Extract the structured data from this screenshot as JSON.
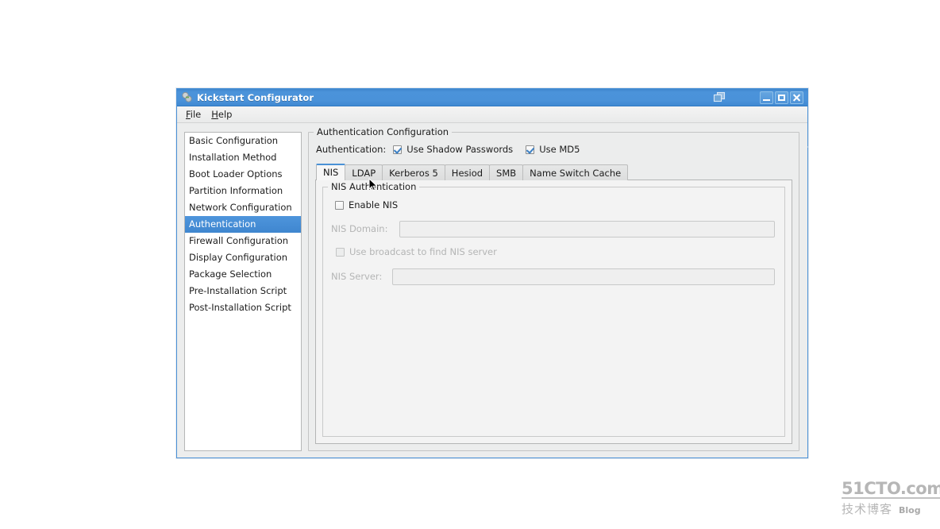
{
  "window": {
    "title": "Kickstart Configurator",
    "app_icon": "app-icon",
    "cascade_icon": "cascade-windows-icon",
    "minimize_label": "_",
    "maximize_label": "□",
    "close_label": "✕",
    "accent_color": "#4a91d6",
    "titlebar_color": "#4a92d9",
    "background_color": "#eceded"
  },
  "menu": {
    "items": [
      {
        "label": "File",
        "mnemonic": "F",
        "rest": "ile"
      },
      {
        "label": "Help",
        "mnemonic": "H",
        "rest": "elp"
      }
    ]
  },
  "sidebar": {
    "selected_index": 5,
    "items": [
      {
        "label": "Basic Configuration"
      },
      {
        "label": "Installation Method"
      },
      {
        "label": "Boot Loader Options"
      },
      {
        "label": "Partition Information"
      },
      {
        "label": "Network Configuration"
      },
      {
        "label": "Authentication"
      },
      {
        "label": "Firewall Configuration"
      },
      {
        "label": "Display Configuration"
      },
      {
        "label": "Package Selection"
      },
      {
        "label": "Pre-Installation Script"
      },
      {
        "label": "Post-Installation Script"
      }
    ]
  },
  "main": {
    "groupbox_title": "Authentication Configuration",
    "auth_row": {
      "label": "Authentication:",
      "options": [
        {
          "label": "Use Shadow Passwords",
          "checked": true,
          "disabled": false
        },
        {
          "label": "Use MD5",
          "checked": true,
          "disabled": false
        }
      ]
    },
    "tabs": [
      {
        "label": "NIS",
        "active": true
      },
      {
        "label": "LDAP",
        "active": false
      },
      {
        "label": "Kerberos 5",
        "active": false
      },
      {
        "label": "Hesiod",
        "active": false
      },
      {
        "label": "SMB",
        "active": false
      },
      {
        "label": "Name Switch Cache",
        "active": false
      }
    ],
    "nis_panel": {
      "groupbox_title": "NIS Authentication",
      "enable_nis": {
        "label": "Enable NIS",
        "checked": false,
        "disabled": false
      },
      "nis_domain": {
        "label": "NIS Domain:",
        "value": "",
        "placeholder": "",
        "disabled": true
      },
      "use_broadcast": {
        "label": "Use broadcast to find NIS server",
        "checked": false,
        "disabled": true
      },
      "nis_server": {
        "label": "NIS Server:",
        "value": "",
        "placeholder": "",
        "disabled": true
      }
    }
  },
  "watermark": {
    "main": "51CTO.com",
    "cn": "技术博客",
    "blog": "Blog"
  }
}
